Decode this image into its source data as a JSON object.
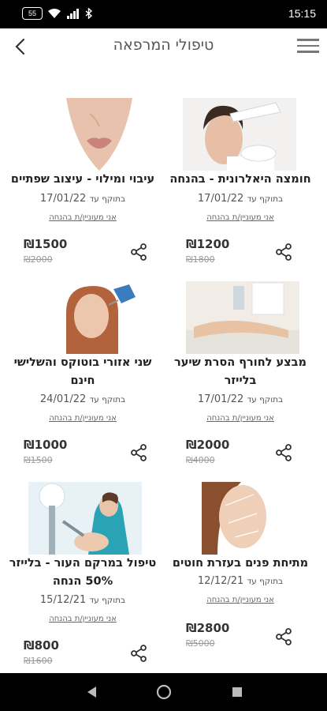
{
  "status": {
    "battery": "55",
    "time": "15:15"
  },
  "header": {
    "title": "טיפולי המרפאה"
  },
  "items": [
    {
      "name": "חומצה היאלרונית - בהנחה",
      "valid_label": "בתוקף עד",
      "valid_date": "17/01/22",
      "interest": "אני מעוניין/ת בהנחה",
      "price": "₪1200",
      "old_price": "₪1800",
      "image": "face-injection-photo"
    },
    {
      "name": "עיבוי ומילוי - עיצוב שפתיים",
      "valid_label": "בתוקף עד",
      "valid_date": "17/01/22",
      "interest": "אני מעוניין/ת בהנחה",
      "price": "₪1500",
      "old_price": "₪2000",
      "image": "lips-photo"
    },
    {
      "name": "מבצע לחורף הסרת שיער בלייזר",
      "valid_label": "בתוקף עד",
      "valid_date": "17/01/22",
      "interest": "אני מעוניין/ת בהנחה",
      "price": "₪2000",
      "old_price": "₪4000",
      "image": "leg-laser-photo"
    },
    {
      "name": "שני אזורי בוטוקס והשלישי חינם",
      "valid_label": "בתוקף עד",
      "valid_date": "24/01/22",
      "interest": "אני מעוניין/ת בהנחה",
      "price": "₪1000",
      "old_price": "₪1500",
      "image": "forehead-botox-photo"
    },
    {
      "name": "מתיחת פנים בעזרת חוטים",
      "valid_label": "בתוקף עד",
      "valid_date": "12/12/21",
      "interest": "אני מעוניין/ת בהנחה",
      "price": "₪2800",
      "old_price": "₪5000",
      "image": "face-lift-photo"
    },
    {
      "name": "טיפול במרקם העור - בלייזר 50% הנחה",
      "valid_label": "בתוקף עד",
      "valid_date": "15/12/21",
      "interest": "אני מעוניין/ת בהנחה",
      "price": "₪800",
      "old_price": "₪1600",
      "image": "skin-laser-photo"
    }
  ]
}
